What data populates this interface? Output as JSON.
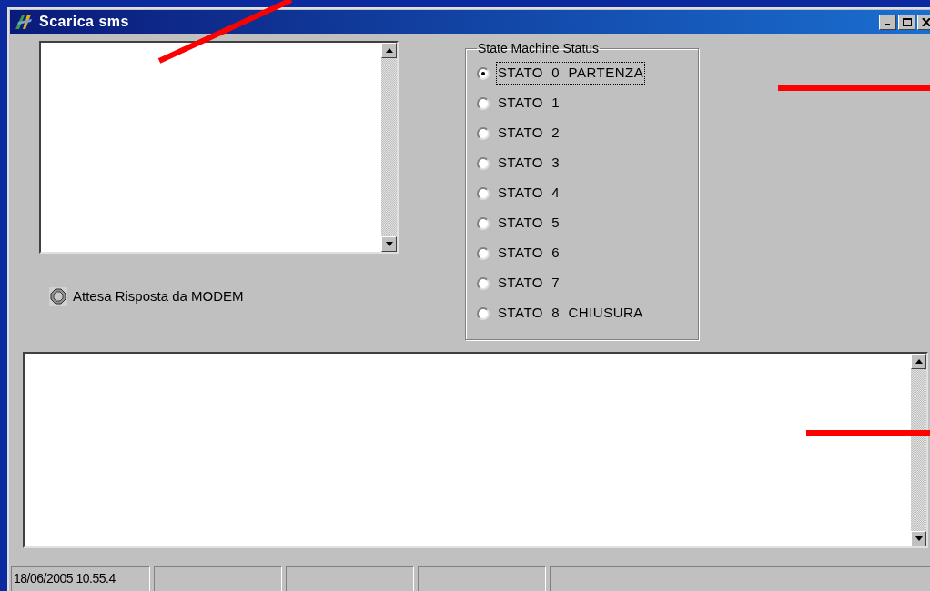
{
  "window": {
    "title": "Scarica sms"
  },
  "indicator": {
    "label": "Attesa Risposta da MODEM"
  },
  "state_group": {
    "title": "State Machine Status",
    "options": [
      {
        "label": "STATO  0  PARTENZA",
        "selected": true
      },
      {
        "label": "STATO  1",
        "selected": false
      },
      {
        "label": "STATO  2",
        "selected": false
      },
      {
        "label": "STATO  3",
        "selected": false
      },
      {
        "label": "STATO  4",
        "selected": false
      },
      {
        "label": "STATO  5",
        "selected": false
      },
      {
        "label": "STATO  6",
        "selected": false
      },
      {
        "label": "STATO  7",
        "selected": false
      },
      {
        "label": "STATO  8  CHIUSURA",
        "selected": false
      }
    ]
  },
  "status_bar": {
    "panels": [
      "18/06/2005 10.55.4"
    ]
  }
}
